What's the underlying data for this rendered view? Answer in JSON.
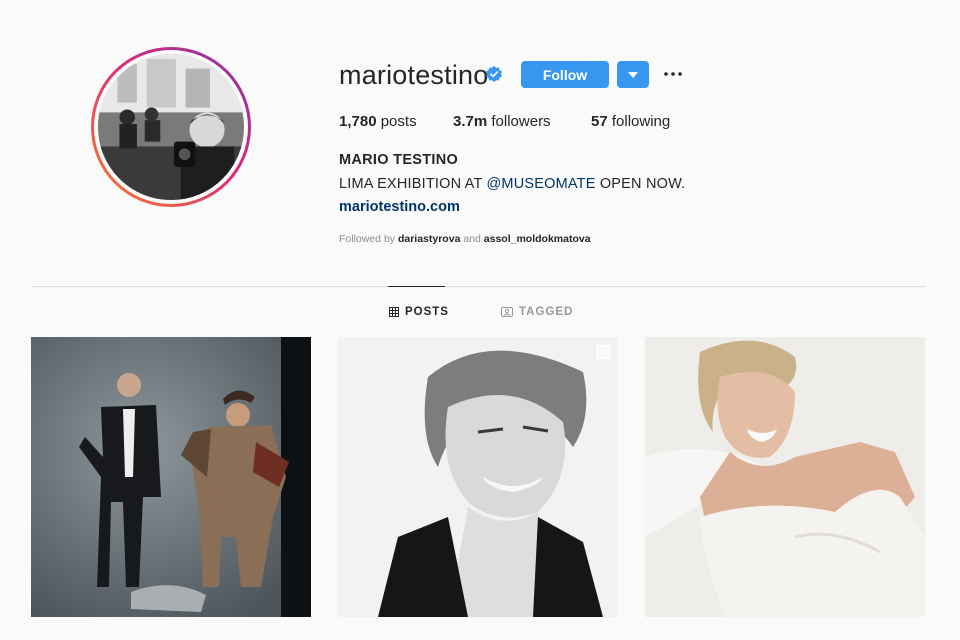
{
  "profile": {
    "username": "mariotestino",
    "verified": true,
    "follow_label": "Follow",
    "full_name": "MARIO TESTINO",
    "bio_prefix": "LIMA EXHIBITION AT ",
    "bio_mention": "@MUSEOMATE",
    "bio_suffix": " OPEN NOW.",
    "website": "mariotestino.com",
    "followed_by_prefix": "Followed by ",
    "followed_by_user1": "dariastyrova",
    "followed_by_and": " and ",
    "followed_by_user2": "assol_moldokmatova"
  },
  "stats": {
    "posts_count": "1,780",
    "posts_label": " posts",
    "followers_count": "3.7m",
    "followers_label": " followers",
    "following_count": "57",
    "following_label": " following"
  },
  "tabs": [
    {
      "label": "POSTS",
      "icon": "grid-icon",
      "active": true
    },
    {
      "label": "TAGGED",
      "icon": "tag-icon",
      "active": false
    }
  ],
  "colors": {
    "accent": "#3897f0",
    "link": "#003569",
    "text": "#262626",
    "muted": "#8e8e8e",
    "background": "#fafafa"
  },
  "posts": [
    {
      "icon": "photo-icon",
      "description_icon": "portrait-photo"
    },
    {
      "icon": "photo-icon",
      "multi": true
    },
    {
      "icon": "photo-icon"
    }
  ]
}
